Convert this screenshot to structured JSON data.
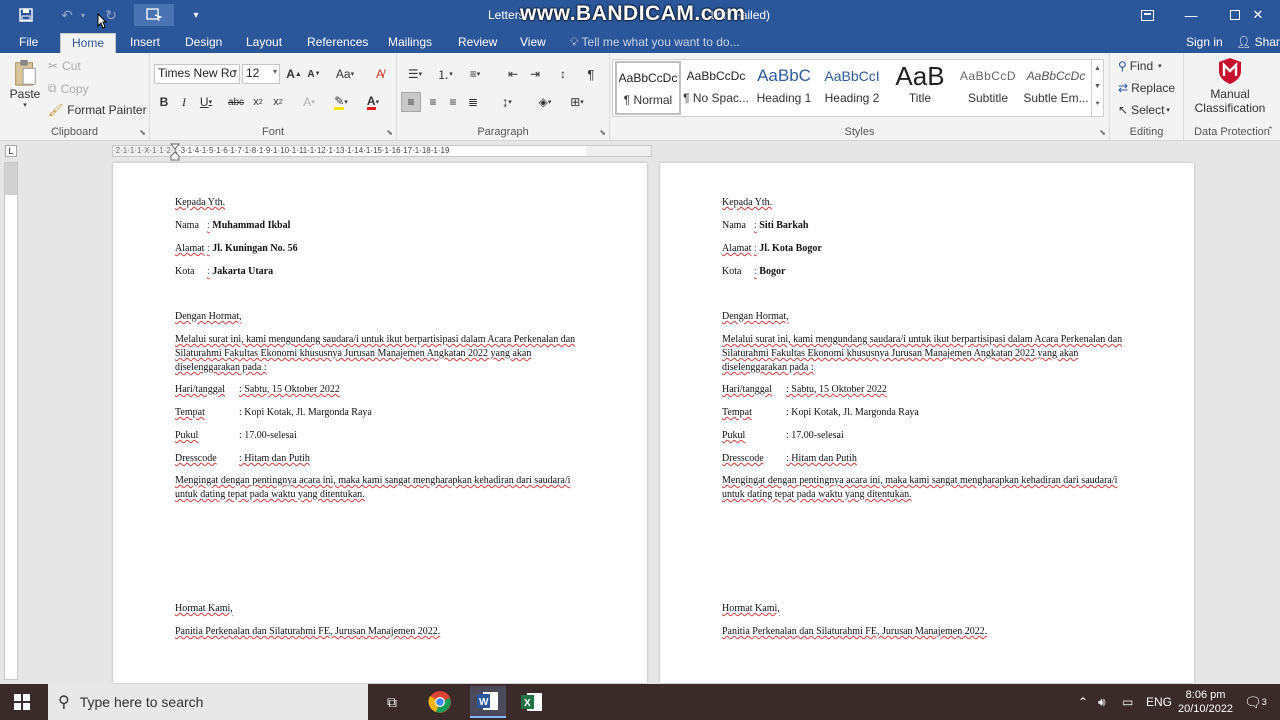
{
  "titlebar": {
    "doc_title": "Letters",
    "doc_title_suffix": "tion Failed)",
    "watermark": "www.BANDICAM.com",
    "accent": "#2b579a"
  },
  "tabs": [
    {
      "label": "File"
    },
    {
      "label": "Home"
    },
    {
      "label": "Insert"
    },
    {
      "label": "Design"
    },
    {
      "label": "Layout"
    },
    {
      "label": "References"
    },
    {
      "label": "Mailings"
    },
    {
      "label": "Review"
    },
    {
      "label": "View"
    }
  ],
  "tellme": "Tell me what you want to do...",
  "signin": "Sign in",
  "share": "Share",
  "clipboard": {
    "paste": "Paste",
    "cut": "Cut",
    "copy": "Copy",
    "format_painter": "Format Painter",
    "label": "Clipboard"
  },
  "font": {
    "name": "Times New Ro",
    "size": "12",
    "label": "Font"
  },
  "paragraph": {
    "label": "Paragraph"
  },
  "styles": {
    "label": "Styles",
    "items": [
      {
        "preview": "AaBbCcDc",
        "name": "¶ Normal"
      },
      {
        "preview": "AaBbCcDc",
        "name": "¶ No Spac..."
      },
      {
        "preview": "AaBbC",
        "name": "Heading 1"
      },
      {
        "preview": "AaBbCcI",
        "name": "Heading 2"
      },
      {
        "preview": "AaB",
        "name": "Title"
      },
      {
        "preview": "AaBbCcD",
        "name": "Subtitle"
      },
      {
        "preview": "AaBbCcDc",
        "name": "Subtle Em..."
      }
    ]
  },
  "editing": {
    "find": "Find",
    "replace": "Replace",
    "select": "Select",
    "label": "Editing"
  },
  "data_protection": {
    "manual": "Manual",
    "classification": "Classification",
    "label": "Data Protection"
  },
  "ruler_text": "·2·1·1·1·X·1·1·2·1·3·1·4·1·5·1·6·1·7·1·8·1·9·1·10·1·11·1·12·1·13·1·14·1·15·1·16·17·1·18·1·19",
  "pages": [
    {
      "salutation": "Kepada Yth.",
      "nama_label": "Nama",
      "nama_value": "Muhammad Ikbal",
      "alamat_label": "Alamat",
      "alamat_value": "Jl. Kuningan No. 56",
      "kota_label": "Kota",
      "kota_value": "Jakarta Utara",
      "greeting": "Dengan Hormat,",
      "body": "Melalui surat ini, kami mengundang saudara/i untuk ikut berpartisipasi dalam Acara Perkenalan dan Silaturahmi Fakultas Ekonomi khususnya Jurusan Manajemen Angkatan 2022 yang akan diselenggarakan pada :",
      "hari_label": "Hari/tanggal",
      "hari_value": ": Sabtu, 15 Oktober 2022",
      "tempat_label": "Tempat",
      "tempat_value": ": Kopi Kotak, Jl. Margonda Raya",
      "pukul_label": "Pukul",
      "pukul_value": ": 17.00-selesai",
      "dress_label": "Dresscode",
      "dress_value": ": Hitam dan Putih",
      "closing_body": "Mengingat dengan pentingnya acara ini, maka kami sangat mengharapkan kehadiran dari saudara/i untuk dating tepat pada waktu yang ditentukan.",
      "regards": "Hormat Kami,",
      "signature": "Panitia Perkenalan dan Silaturahmi FE, Jurusan Manajemen 2022."
    },
    {
      "salutation": "Kepada Yth.",
      "nama_label": "Nama",
      "nama_value": "Siti Barkah",
      "alamat_label": "Alamat",
      "alamat_value": "Jl. Kota Bogor",
      "kota_label": "Kota",
      "kota_value": "Bogor",
      "greeting": "Dengan Hormat,",
      "body": "Melalui surat ini, kami mengundang saudara/i untuk ikut berpartisipasi dalam Acara Perkenalan dan Silaturahmi Fakultas Ekonomi khususnya Jurusan Manajemen Angkatan 2022 yang akan diselenggarakan pada :",
      "hari_label": "Hari/tanggal",
      "hari_value": ": Sabtu, 15 Oktober 2022",
      "tempat_label": "Tempat",
      "tempat_value": ": Kopi Kotak, Jl. Margonda Raya",
      "pukul_label": "Pukul",
      "pukul_value": ": 17.00-selesai",
      "dress_label": "Dresscode",
      "dress_value": ": Hitam dan Putih",
      "closing_body": "Mengingat dengan pentingnya acara ini, maka kami sangat mengharapkan kehadiran dari saudara/i untuk dating tepat pada waktu yang ditentukan.",
      "regards": "Hormat Kami,",
      "signature": "Panitia Perkenalan dan Silaturahmi FE, Jurusan Manajemen 2022."
    }
  ],
  "taskbar": {
    "search_placeholder": "Type here to search",
    "lang": "ENG",
    "time": "8:06 pm",
    "date": "20/10/2022",
    "notif_count": "3"
  }
}
